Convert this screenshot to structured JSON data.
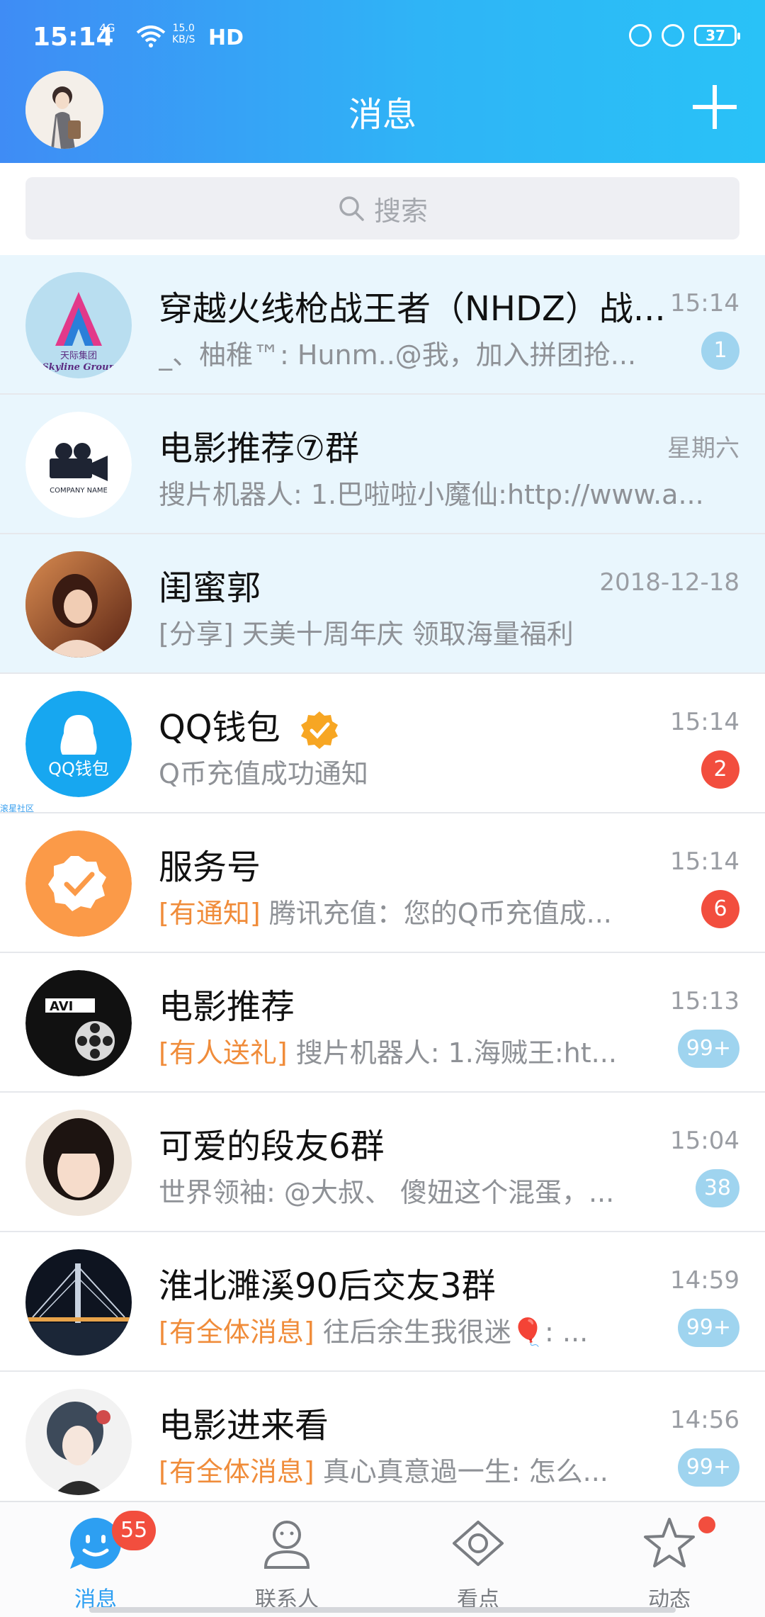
{
  "status_bar": {
    "time": "15:14",
    "network": "4G",
    "speed_value": "15.0",
    "speed_unit": "KB/S",
    "hd": "HD",
    "battery": "37"
  },
  "header": {
    "title": "消息",
    "plus_icon": "plus-icon",
    "bg_from": "#3f8cf5",
    "bg_to": "#29c2f7"
  },
  "search": {
    "placeholder": "搜索"
  },
  "chats": [
    {
      "name": "穿越火线枪战王者（NHDZ）战...",
      "time": "15:14",
      "preview": "_、柚稚™: Hunm..@我，加入拼团抢...",
      "badge": "1",
      "badge_color": "blue",
      "pinned": true
    },
    {
      "name": "电影推荐⑦群",
      "time": "星期六",
      "preview": "搜片机器人: 1.巴啦啦小魔仙:http://www.a...",
      "badge": "",
      "pinned": true
    },
    {
      "name": "闺蜜郭",
      "time": "2018-12-18",
      "preview": "[分享] 天美十周年庆 领取海量福利",
      "badge": "",
      "pinned": true
    },
    {
      "name": "QQ钱包",
      "time": "15:14",
      "preview": "Q币充值成功通知",
      "badge": "2",
      "badge_color": "red",
      "verified": true
    },
    {
      "name": "服务号",
      "time": "15:14",
      "tag": "[有通知]",
      "preview": " 腾讯充值：您的Q币充值成...",
      "badge": "6",
      "badge_color": "red"
    },
    {
      "name": "电影推荐",
      "time": "15:13",
      "tag": "[有人送礼]",
      "preview": " 搜片机器人: 1.海贼王:ht...",
      "badge": "99+",
      "badge_color": "blue"
    },
    {
      "name": "可爱的段友6群",
      "time": "15:04",
      "preview": "世界领袖: @大叔、 傻妞这个混蛋，...",
      "badge": "38",
      "badge_color": "blue"
    },
    {
      "name": "淮北濉溪90后交友3群",
      "time": "14:59",
      "tag": "[有全体消息]",
      "preview": " 往后余生我很迷🎈: ...",
      "badge": "99+",
      "badge_color": "blue"
    },
    {
      "name": "电影进来看",
      "time": "14:56",
      "tag": "[有全体消息]",
      "preview": " 真心真意過一生: 怎么...",
      "badge": "99+",
      "badge_color": "blue"
    }
  ],
  "avatar_texts": {
    "wallet": "QQ钱包",
    "company": "COMPANY NAME",
    "skyline": "Skyline Group",
    "skyline_cn": "天际集团",
    "avi": "AVI",
    "side_label": "滚星社区"
  },
  "bottom_nav": {
    "items": [
      {
        "label": "消息",
        "icon": "chat-bubble-icon",
        "active": true,
        "badge": "55"
      },
      {
        "label": "联系人",
        "icon": "contacts-icon",
        "active": false
      },
      {
        "label": "看点",
        "icon": "eye-icon",
        "active": false
      },
      {
        "label": "动态",
        "icon": "star-icon",
        "active": false,
        "dot": true
      }
    ]
  },
  "colors": {
    "accent": "#2d9ff2",
    "badge_red": "#f24e3e",
    "badge_blue": "#9fd4ef",
    "tag_orange": "#f08c3a",
    "pinned_bg": "#e9f6fd"
  }
}
